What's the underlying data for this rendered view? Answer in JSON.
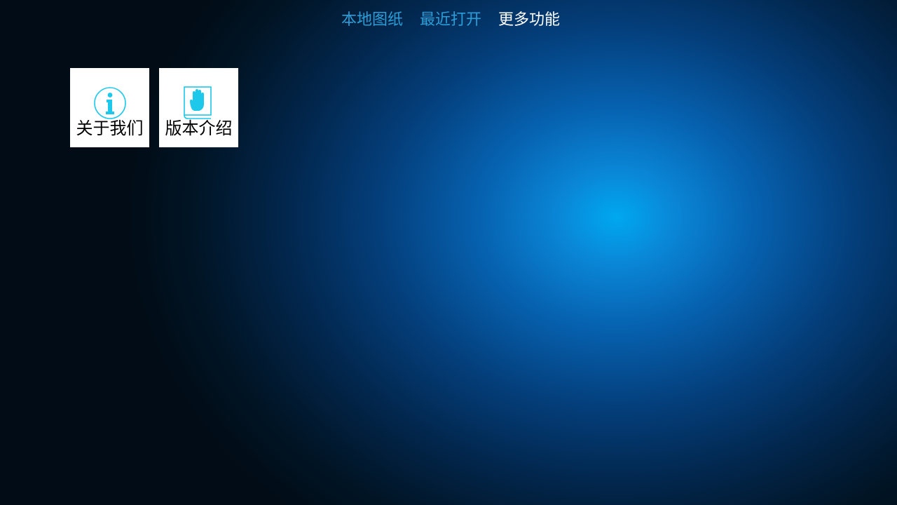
{
  "tabs": [
    {
      "label": "本地图纸",
      "active": false
    },
    {
      "label": "最近打开",
      "active": false
    },
    {
      "label": "更多功能",
      "active": true
    }
  ],
  "tiles": [
    {
      "label": "关于我们",
      "icon": "info-icon"
    },
    {
      "label": "版本介绍",
      "icon": "hand-book-icon"
    }
  ],
  "colors": {
    "tab_inactive": "#2a9ed8",
    "tab_active": "#ffffff",
    "icon_accent": "#1ec8ea",
    "background_glow": "#00a8f0",
    "background_dark": "#010c16"
  }
}
